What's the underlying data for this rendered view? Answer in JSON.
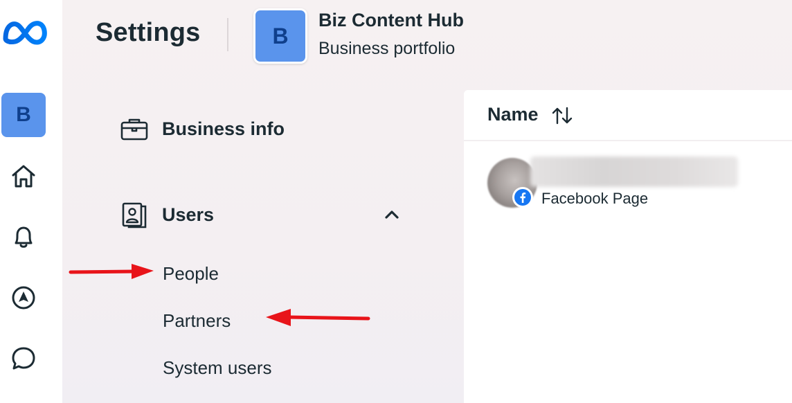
{
  "rail": {
    "portfolio_initial": "B",
    "icons": [
      "meta-logo-icon",
      "home-icon",
      "bell-icon",
      "navigation-icon",
      "chat-icon"
    ]
  },
  "header": {
    "title": "Settings",
    "portfolio_initial": "B",
    "portfolio_name": "Biz Content Hub",
    "portfolio_type": "Business portfolio"
  },
  "nav": {
    "business_info": {
      "label": "Business info",
      "icon": "briefcase-icon"
    },
    "users": {
      "label": "Users",
      "icon": "id-badge-icon",
      "expanded": true,
      "children": [
        "People",
        "Partners",
        "System users"
      ]
    }
  },
  "annotations": {
    "arrow_color": "#e8141a",
    "arrows": [
      "people-arrow",
      "partners-arrow"
    ]
  },
  "table": {
    "column_header": "Name",
    "sort_icon": "sort-up-down-icon",
    "rows": [
      {
        "type": "Facebook Page",
        "badge_icon": "facebook-icon"
      }
    ]
  },
  "colors": {
    "accent_blue": "#5a94ec",
    "facebook_blue": "#1877f2",
    "text": "#1c2b33"
  }
}
